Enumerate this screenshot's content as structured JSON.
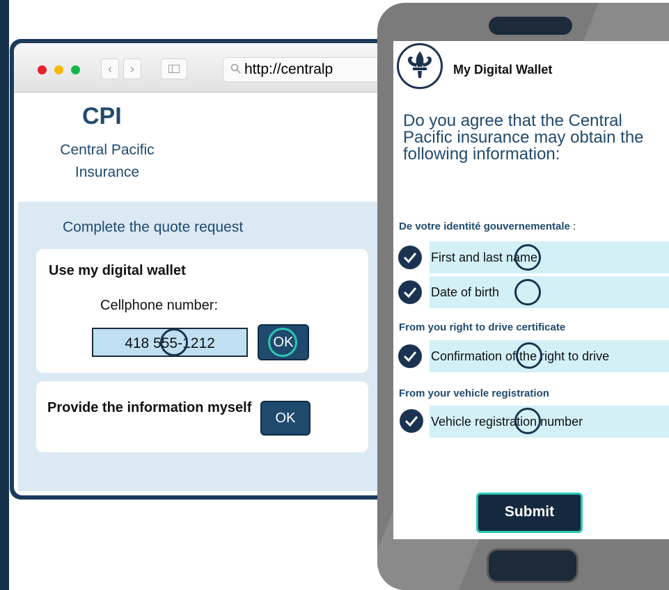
{
  "browser": {
    "url": "http://centralp",
    "brand_short": "CPI",
    "brand_name": "Central Pacific Insurance",
    "quote_title": "Complete the quote request",
    "digital_wallet_card": {
      "title": "Use my digital wallet",
      "phone_label": "Cellphone number:",
      "phone_value": "418 555-1212",
      "ok_label": "OK"
    },
    "manual_card": {
      "title": "Provide the information myself",
      "ok_label": "OK"
    }
  },
  "wallet": {
    "title": "My Digital Wallet",
    "question": "Do you agree that the Central Pacific insurance may obtain the following information:",
    "sections": [
      {
        "heading": "De votre identité gouvernementale",
        "suffix": " :",
        "items": [
          "First and last name",
          "Date of birth"
        ]
      },
      {
        "heading": "From you right to drive certificate",
        "items": [
          "Confirmation of the right to drive"
        ]
      },
      {
        "heading": "From your vehicle registration",
        "items": [
          "Vehicle registration number"
        ]
      }
    ],
    "submit_label": "Submit"
  },
  "colors": {
    "brand_navy": "#1f4a6e",
    "dark_navy": "#14293e",
    "teal_accent": "#2bc7b4",
    "panel_blue": "#dbe9f3",
    "row_highlight": "#d3f0f7",
    "phone_gray": "#7b7b7b"
  },
  "icons": [
    "back-arrow-icon",
    "forward-arrow-icon",
    "sidebar-icon",
    "search-icon",
    "fleur-de-lis-icon",
    "checkmark-icon"
  ]
}
